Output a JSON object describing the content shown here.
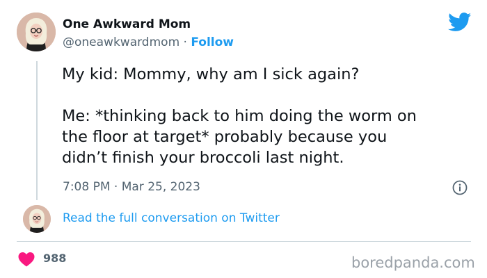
{
  "author": {
    "name": "One Awkward Mom",
    "handle": "@oneawkwardmom",
    "separator": " · ",
    "follow_label": "Follow"
  },
  "tweet": {
    "lines": [
      "My kid: Mommy, why am I sick again?",
      "Me: *thinking back to him doing the worm on\nthe floor at target* probably because you\ndidn’t finish your broccoli last night."
    ],
    "time": "7:08 PM",
    "date_separator": " · ",
    "date": "Mar 25, 2023"
  },
  "conversation_link": "Read the full conversation on Twitter",
  "likes": {
    "count": "988"
  },
  "watermark": "boredpanda.com",
  "icons": {
    "brand": "twitter-bird-icon",
    "info": "info-icon",
    "like": "heart-icon"
  },
  "colors": {
    "brand_blue": "#1d9bf0",
    "text": "#0f1419",
    "muted": "#536471",
    "like_red": "#f91880"
  }
}
